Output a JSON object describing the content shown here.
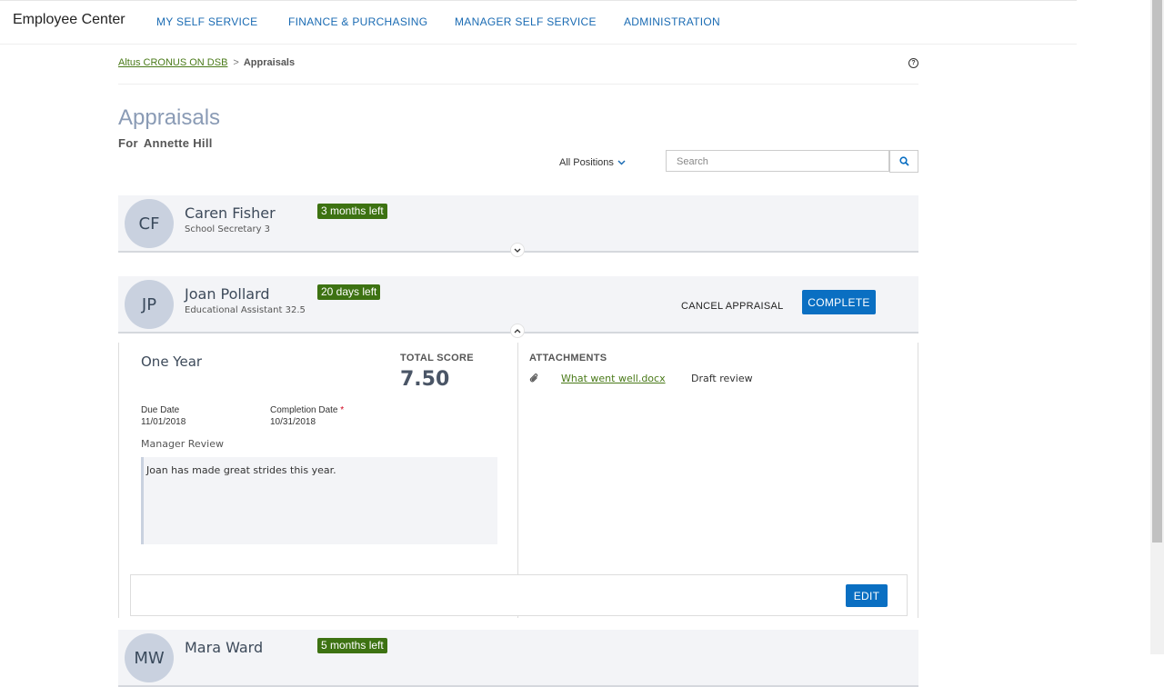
{
  "app": {
    "title": "Employee Center"
  },
  "nav": {
    "items": [
      {
        "label": "MY SELF SERVICE"
      },
      {
        "label": "FINANCE & PURCHASING"
      },
      {
        "label": "MANAGER SELF SERVICE"
      },
      {
        "label": "ADMINISTRATION"
      }
    ]
  },
  "breadcrumb": {
    "root": "Altus CRONUS ON DSB",
    "separator": ">",
    "current": "Appraisals"
  },
  "page": {
    "title": "Appraisals",
    "for_label": "For",
    "for_name": "Annette Hill"
  },
  "filters": {
    "positions_label": "All Positions"
  },
  "search": {
    "placeholder": "Search"
  },
  "icons": {
    "help": "help-circle-icon",
    "search": "search-icon",
    "expand": "chevron-down-icon",
    "collapse": "chevron-up-icon",
    "attachment": "paperclip-icon"
  },
  "colors": {
    "accent": "#0a6fc2",
    "badge": "#3d7212",
    "link": "#4a7a19"
  },
  "appraisals": [
    {
      "initials": "CF",
      "name": "Caren Fisher",
      "role": "School Secretary 3",
      "badge": "3 months left"
    },
    {
      "initials": "JP",
      "name": "Joan Pollard",
      "role": "Educational Assistant 32.5",
      "badge": "20 days left",
      "cancel_label": "CANCEL APPRAISAL",
      "complete_label": "COMPLETE",
      "detail": {
        "stage": "One Year",
        "total_score_label": "TOTAL SCORE",
        "total_score": "7.50",
        "due_date_label": "Due Date",
        "due_date": "11/01/2018",
        "completion_date_label": "Completion Date",
        "completion_required": "*",
        "completion_date": "10/31/2018",
        "manager_review_label": "Manager Review",
        "manager_review_text": "Joan has made great strides this year.",
        "attachments_label": "ATTACHMENTS",
        "attachments": [
          {
            "file": "What went well.docx",
            "description": "Draft review"
          }
        ],
        "edit_label": "EDIT"
      }
    },
    {
      "initials": "MW",
      "name": "Mara Ward",
      "role": "",
      "badge": "5 months left"
    }
  ]
}
